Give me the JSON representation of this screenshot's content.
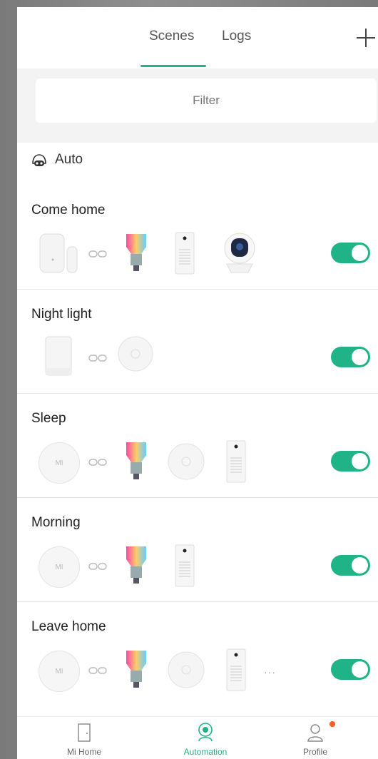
{
  "header": {
    "tabs": [
      {
        "label": "Scenes",
        "active": true
      },
      {
        "label": "Logs",
        "active": false
      }
    ],
    "add_icon": "plus-icon"
  },
  "filter": {
    "label": "Filter"
  },
  "auto": {
    "label": "Auto",
    "icon": "robot-icon"
  },
  "scenes": [
    {
      "title": "Come home",
      "enabled": true,
      "devices": [
        "door-sensor-icon",
        "bulb-icon",
        "air-purifier-icon",
        "camera-icon"
      ]
    },
    {
      "title": "Night light",
      "enabled": true,
      "devices": [
        "motion-sensor-icon",
        "ceiling-light-icon"
      ]
    },
    {
      "title": "Sleep",
      "enabled": true,
      "devices": [
        "wireless-switch-icon",
        "bulb-icon",
        "ceiling-light-icon",
        "air-purifier-icon"
      ]
    },
    {
      "title": "Morning",
      "enabled": true,
      "devices": [
        "wireless-switch-icon",
        "bulb-icon",
        "air-purifier-icon"
      ]
    },
    {
      "title": "Leave home",
      "enabled": true,
      "devices": [
        "wireless-switch-icon",
        "bulb-icon",
        "ceiling-light-icon",
        "air-purifier-icon"
      ],
      "more": "···"
    }
  ],
  "switch_label": "MI",
  "nav": [
    {
      "label": "Mi Home",
      "icon": "door-icon",
      "active": false
    },
    {
      "label": "Automation",
      "icon": "automation-icon",
      "active": true
    },
    {
      "label": "Profile",
      "icon": "profile-icon",
      "active": false
    }
  ],
  "colors": {
    "accent": "#1fb387",
    "badge": "#ff5a1f"
  }
}
